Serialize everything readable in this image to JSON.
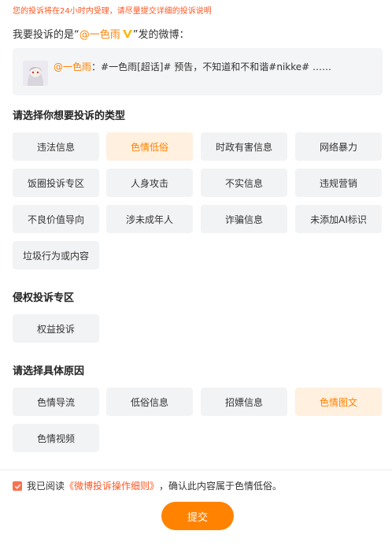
{
  "notice": "您的投诉将在24小时内受理，请尽量提交详细的投诉说明",
  "target": {
    "prefix": "我要投诉的是“",
    "username": "@一色雨",
    "suffix": "”发的微博："
  },
  "preview": {
    "author": "@一色雨",
    "content": "：#一色雨[超话]# 预告，不知道和不和谐#nikke# ……"
  },
  "type_section": {
    "title": "请选择你想要投诉的类型",
    "options": [
      "违法信息",
      "色情低俗",
      "时政有害信息",
      "网络暴力",
      "饭圈投诉专区",
      "人身攻击",
      "不实信息",
      "违规营销",
      "不良价值导向",
      "涉未成年人",
      "诈骗信息",
      "未添加AI标识",
      "垃圾行为或内容"
    ],
    "selected": "色情低俗"
  },
  "rights_section": {
    "title": "侵权投诉专区",
    "options": [
      "权益投诉"
    ]
  },
  "reason_section": {
    "title": "请选择具体原因",
    "options": [
      "色情导流",
      "低俗信息",
      "招嫖信息",
      "色情图文",
      "色情视频"
    ],
    "selected": "色情图文"
  },
  "agreement": {
    "checked": true,
    "prefix": "我已阅读",
    "link": "《微博投诉操作细则》",
    "suffix": "，确认此内容属于色情低俗。"
  },
  "submit_label": "提交",
  "colors": {
    "accent": "#ff8200",
    "notice": "#ff5722",
    "selected_bg": "#fff0e0",
    "button_bg": "#f2f3f5"
  }
}
